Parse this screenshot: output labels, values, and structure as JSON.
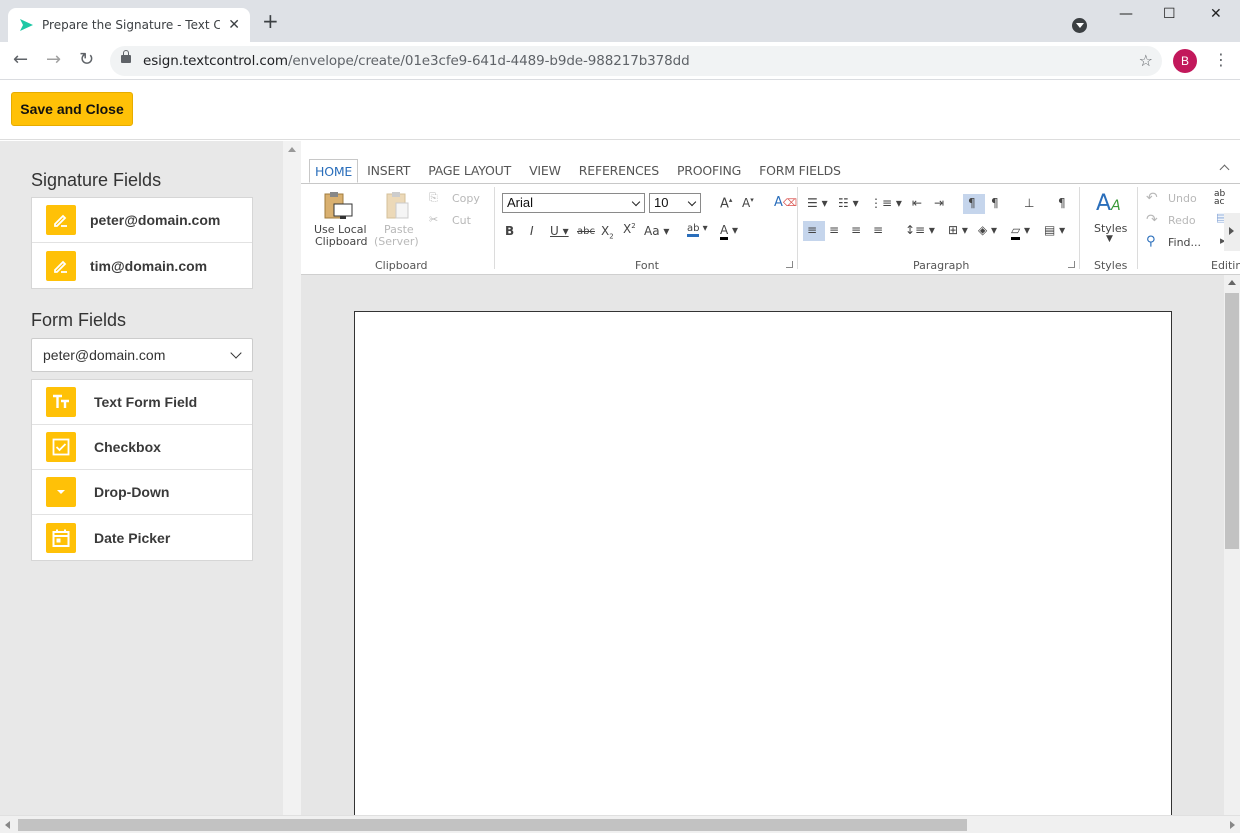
{
  "browser": {
    "tab_title": "Prepare the Signature - Text Control",
    "tab_close": "✕",
    "new_tab": "+",
    "url_host": "esign.textcontrol.com",
    "url_path": "/envelope/create/01e3cfe9-641d-4489-b9de-988217b378dd",
    "profile_initial": "B",
    "window_min": "—",
    "window_max": "☐",
    "window_close": "✕"
  },
  "header": {
    "save_label": "Save and Close"
  },
  "left_panel": {
    "signature_title": "Signature Fields",
    "signature_items": [
      {
        "label": "peter@domain.com",
        "icon": "pen-icon"
      },
      {
        "label": "tim@domain.com",
        "icon": "pen-icon"
      }
    ],
    "form_title": "Form Fields",
    "recipient_selected": "peter@domain.com",
    "form_items": [
      {
        "label": "Text Form Field",
        "icon": "text-field-icon"
      },
      {
        "label": "Checkbox",
        "icon": "checkbox-icon"
      },
      {
        "label": "Drop-Down",
        "icon": "dropdown-icon"
      },
      {
        "label": "Date Picker",
        "icon": "calendar-icon"
      }
    ]
  },
  "ribbon": {
    "tabs": [
      "HOME",
      "INSERT",
      "PAGE LAYOUT",
      "VIEW",
      "REFERENCES",
      "PROOFING",
      "FORM FIELDS"
    ],
    "active_tab": "HOME",
    "clipboard": {
      "use_local_line1": "Use Local",
      "use_local_line2": "Clipboard",
      "paste_line1": "Paste",
      "paste_line2": "(Server)",
      "copy": "Copy",
      "cut": "Cut",
      "group": "Clipboard"
    },
    "font": {
      "family": "Arial",
      "size": "10",
      "group": "Font"
    },
    "paragraph": {
      "group": "Paragraph"
    },
    "styles": {
      "label": "Styles",
      "group": "Styles"
    },
    "editing": {
      "undo": "Undo",
      "redo": "Redo",
      "find": "Find...",
      "group": "Editing"
    }
  },
  "colors": {
    "accent": "#ffc107",
    "tab_active": "#2a6ebb",
    "panel_bg": "#e8e8e8"
  }
}
